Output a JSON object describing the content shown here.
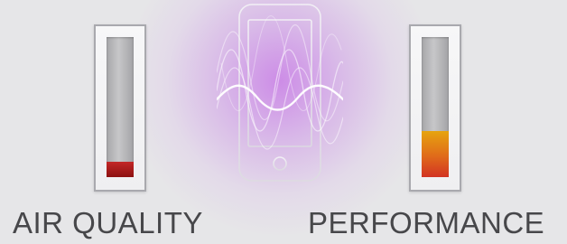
{
  "meters": {
    "air_quality": {
      "label": "AIR QUALITY",
      "level": 0.11,
      "fill_colors": [
        "#c32828",
        "#8c1111"
      ]
    },
    "performance": {
      "label": "PERFORMANCE",
      "level": 0.33,
      "fill_colors": [
        "#e6a40f",
        "#e06a1a",
        "#d23323"
      ]
    }
  },
  "center_graphic": {
    "icon": "smartphone-waveform-icon",
    "glow_color": "#c46ee6"
  }
}
